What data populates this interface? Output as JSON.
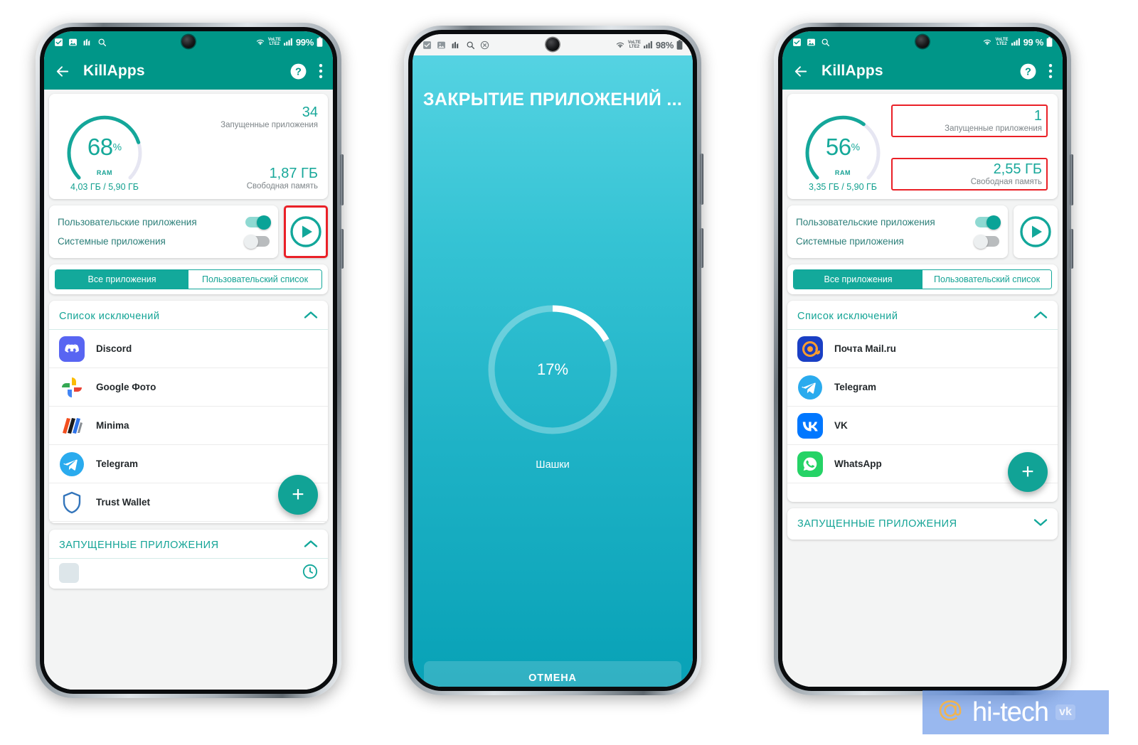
{
  "phones": [
    {
      "id": "phone-left",
      "status_bar": {
        "icons": [
          "checkbox-icon",
          "image-icon",
          "chart-icon",
          "search-icon"
        ],
        "network": "LTE2",
        "volte": "VoLTE",
        "battery": "99%"
      },
      "appbar": {
        "title": "KillApps",
        "back": "back-arrow-icon",
        "help": "help-icon",
        "menu": "overflow-menu-icon"
      },
      "ram": {
        "percent": "68",
        "percent_symbol": "%",
        "ram_label": "RAM",
        "memory_usage": "4,03 ГБ / 5,90 ГБ",
        "running_count": "34",
        "running_label": "Запущенные приложения",
        "free_value": "1,87 ГБ",
        "free_label": "Свободная память",
        "running_highlighted": false,
        "free_highlighted": false,
        "gauge_fill": 68
      },
      "toggles": {
        "user_apps_label": "Пользовательские приложения",
        "user_apps_on": true,
        "system_apps_label": "Системные приложения",
        "system_apps_on": false,
        "play_highlighted": true
      },
      "segmented": {
        "active": "Все приложения",
        "inactive": "Пользовательский список"
      },
      "exclusion": {
        "title": "Список исключений",
        "expanded": true,
        "apps": [
          {
            "name": "Discord",
            "icon": "discord-icon"
          },
          {
            "name": "Google Фото",
            "icon": "google-photos-icon"
          },
          {
            "name": "Minima",
            "icon": "minima-icon"
          },
          {
            "name": "Telegram",
            "icon": "telegram-icon"
          },
          {
            "name": "Trust Wallet",
            "icon": "trust-wallet-icon"
          }
        ],
        "fab_label": "+"
      },
      "running_section": {
        "title": "Запущенные приложения",
        "expanded": true
      },
      "navbar": {
        "recent": "recent-apps-icon",
        "home": "home-icon",
        "back": "back-nav-icon"
      }
    },
    {
      "id": "phone-right",
      "status_bar": {
        "icons": [
          "checkbox-icon",
          "image-icon",
          "search-icon"
        ],
        "network": "LTE2",
        "volte": "VoLTE",
        "battery": "99 %"
      },
      "appbar": {
        "title": "KillApps",
        "back": "back-arrow-icon",
        "help": "help-icon",
        "menu": "overflow-menu-icon"
      },
      "ram": {
        "percent": "56",
        "percent_symbol": "%",
        "ram_label": "RAM",
        "memory_usage": "3,35 ГБ / 5,90 ГБ",
        "running_count": "1",
        "running_label": "Запущенные приложения",
        "free_value": "2,55 ГБ",
        "free_label": "Свободная память",
        "running_highlighted": true,
        "free_highlighted": true,
        "gauge_fill": 56
      },
      "toggles": {
        "user_apps_label": "Пользовательские приложения",
        "user_apps_on": true,
        "system_apps_label": "Системные приложения",
        "system_apps_on": false,
        "play_highlighted": false
      },
      "segmented": {
        "active": "Все приложения",
        "inactive": "Пользовательский список"
      },
      "exclusion": {
        "title": "Список исключений",
        "expanded": true,
        "apps": [
          {
            "name": "Почта Mail.ru",
            "icon": "mailru-icon"
          },
          {
            "name": "Telegram",
            "icon": "telegram-icon"
          },
          {
            "name": "VK",
            "icon": "vk-icon"
          },
          {
            "name": "WhatsApp",
            "icon": "whatsapp-icon"
          }
        ],
        "fab_label": "+"
      },
      "running_section": {
        "title": "Запущенные приложения",
        "expanded": false
      },
      "navbar": {
        "recent": "recent-apps-icon",
        "home": "home-icon",
        "back": "back-nav-icon"
      }
    }
  ],
  "phone_center": {
    "id": "phone-center",
    "status_bar": {
      "icons": [
        "checkbox-icon",
        "image-icon",
        "chart-icon",
        "search-icon",
        "cancel-circle-icon"
      ],
      "network": "LTE2",
      "volte": "VoLTE",
      "battery": "98%"
    },
    "kill": {
      "title": "ЗАКРЫТИЕ ПРИЛОЖЕНИЙ ...",
      "progress_percent": "17%",
      "progress_value": 17,
      "current_app": "Шашки",
      "cancel_label": "ОТМЕНА"
    }
  },
  "watermark": {
    "text": "hi-tech",
    "at": "@",
    "vk": "vk"
  },
  "colors": {
    "teal_primary": "#009688",
    "teal_accent": "#12a79a",
    "highlight_red": "#ea2027",
    "cyan_top": "#55d3e2",
    "cyan_bottom": "#06a0b5",
    "watermark_blue": "#5b8ce5"
  }
}
